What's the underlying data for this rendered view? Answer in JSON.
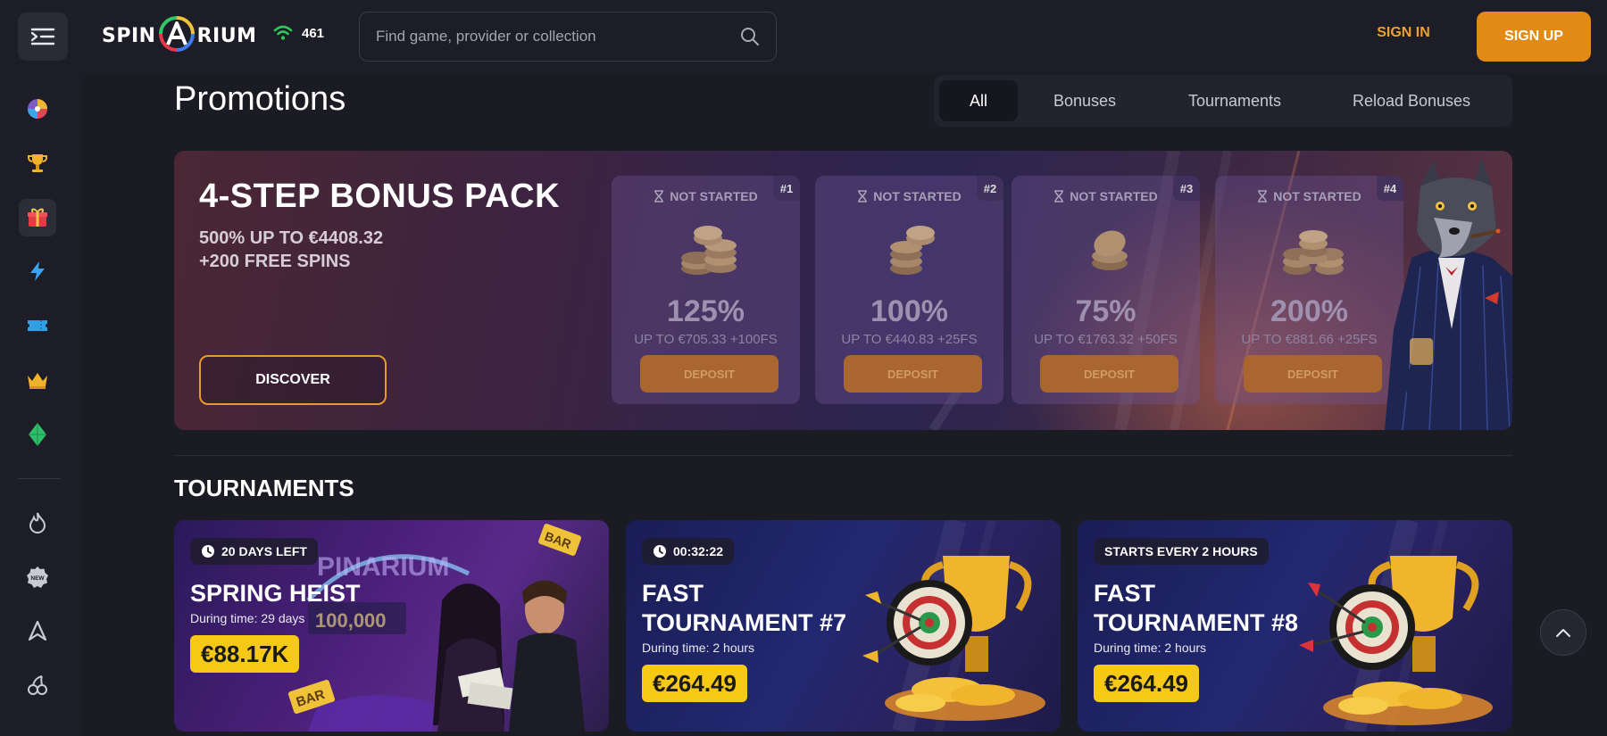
{
  "header": {
    "logo_text_left": "SPIN",
    "logo_text_right": "RIUM",
    "logo_mark": "A",
    "online_count": "461",
    "search_placeholder": "Find game, provider or collection",
    "sign_in": "SIGN IN",
    "sign_up": "SIGN UP"
  },
  "sidebar": {
    "items": [
      {
        "icon": "wheel-icon"
      },
      {
        "icon": "trophy-icon"
      },
      {
        "icon": "gift-icon",
        "active": true
      },
      {
        "icon": "lightning-icon"
      },
      {
        "icon": "ticket-icon"
      },
      {
        "icon": "crown-icon"
      },
      {
        "icon": "gem-icon"
      },
      {
        "icon": "fire-icon"
      },
      {
        "icon": "new-badge-icon",
        "label": "NEW"
      },
      {
        "icon": "brand-a-icon"
      },
      {
        "icon": "cherries-icon"
      }
    ]
  },
  "page": {
    "title": "Promotions",
    "filters": [
      "All",
      "Bonuses",
      "Tournaments",
      "Reload Bonuses"
    ],
    "active_filter": "All"
  },
  "bonus_pack": {
    "title": "4-STEP BONUS PACK",
    "line1": "500% UP TO €4408.32",
    "line2": "+200 FREE SPINS",
    "discover": "DISCOVER",
    "steps": [
      {
        "status": "NOT STARTED",
        "num": "#1",
        "pct": "125%",
        "up_to": "UP TO €705.33 +100FS",
        "deposit": "DEPOSIT"
      },
      {
        "status": "NOT STARTED",
        "num": "#2",
        "pct": "100%",
        "up_to": "UP TO €440.83 +25FS",
        "deposit": "DEPOSIT"
      },
      {
        "status": "NOT STARTED",
        "num": "#3",
        "pct": "75%",
        "up_to": "UP TO €1763.32 +50FS",
        "deposit": "DEPOSIT"
      },
      {
        "status": "NOT STARTED",
        "num": "#4",
        "pct": "200%",
        "up_to": "UP TO €881.66 +25FS",
        "deposit": "DEPOSIT"
      }
    ]
  },
  "tournaments": {
    "title": "TOURNAMENTS",
    "cards": [
      {
        "badge": "20 DAYS LEFT",
        "title_line1": "SPRING HEIST",
        "title_line2": "",
        "during": "During time: 29 days",
        "prize": "€88.17K",
        "art_sign": "PINARIUM",
        "art_amount": "100,000",
        "art_bar": "BAR"
      },
      {
        "badge": "00:32:22",
        "title_line1": "FAST",
        "title_line2": "TOURNAMENT #7",
        "during": "During time: 2 hours",
        "prize": "€264.49"
      },
      {
        "badge": "STARTS EVERY 2 HOURS",
        "title_line1": "FAST",
        "title_line2": "TOURNAMENT #8",
        "during": "During time: 2 hours",
        "prize": "€264.49"
      }
    ]
  },
  "colors": {
    "accent": "#e28a16",
    "sign_in": "#f0a12c",
    "prize_yellow": "#f6c917",
    "background": "#1b1b24"
  }
}
